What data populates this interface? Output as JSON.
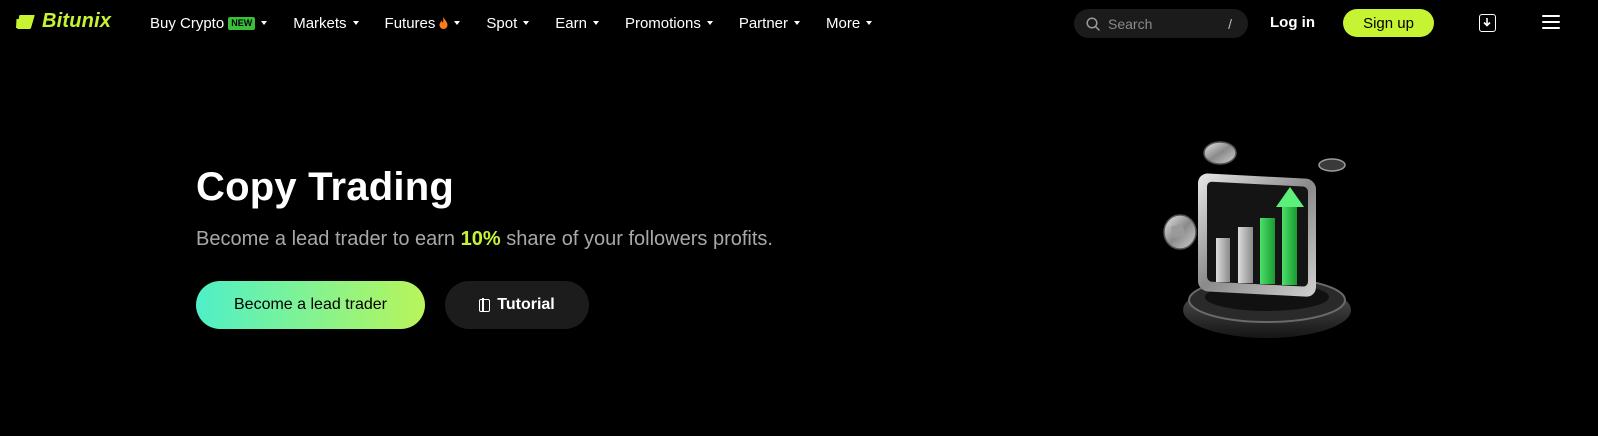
{
  "brand": {
    "name": "Bitunix",
    "accent": "#c6f432"
  },
  "nav": {
    "items": [
      {
        "label": "Buy Crypto",
        "badge": "NEW"
      },
      {
        "label": "Markets"
      },
      {
        "label": "Futures",
        "icon": "fire-icon"
      },
      {
        "label": "Spot"
      },
      {
        "label": "Earn"
      },
      {
        "label": "Promotions"
      },
      {
        "label": "Partner"
      },
      {
        "label": "More"
      }
    ]
  },
  "search": {
    "placeholder": "Search",
    "shortcut": "/"
  },
  "auth": {
    "login_label": "Log in",
    "signup_label": "Sign up"
  },
  "icons": {
    "download": "download-app-icon",
    "menu": "hamburger-menu-icon"
  },
  "hero": {
    "title": "Copy Trading",
    "subtitle_before": "Become a lead trader to earn ",
    "subtitle_highlight": "10%",
    "subtitle_after": " share of your followers profits.",
    "primary_button": "Become a lead trader",
    "secondary_button": "Tutorial",
    "illustration": "rising-bar-chart-with-coins-illustration"
  }
}
